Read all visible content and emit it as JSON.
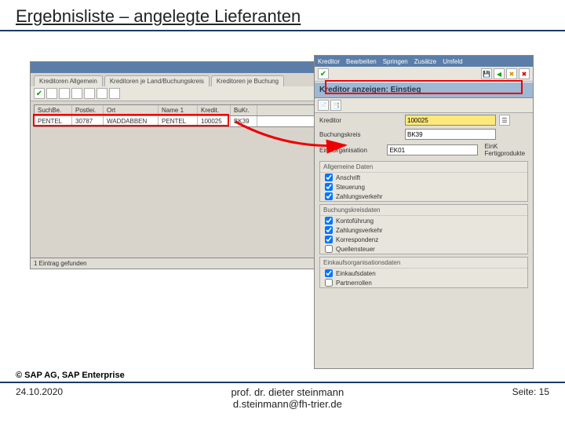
{
  "slide": {
    "title": "Ergebnisliste – angelegte Lieferanten",
    "copyright": "© SAP AG, SAP Enterprise",
    "date": "24.10.2020",
    "author_line1": "prof. dr. dieter steinmann",
    "author_line2": "d.steinmann@fh-trier.de",
    "page": "Seite: 15"
  },
  "win1": {
    "tabs": [
      "Kreditoren Allgemein",
      "Kreditoren je Land/Buchungskreis",
      "Kreditoren je Buchung"
    ],
    "cols": [
      "SuchBe.",
      "Postlei.",
      "Ort",
      "Name 1",
      "Kredit.",
      "BuKr."
    ],
    "row": [
      "PENTEL",
      "30787",
      "WADDABBEN",
      "PENTEL",
      "100025",
      "BK39"
    ],
    "status": "1 Eintrag gefunden"
  },
  "win2": {
    "menu": [
      "Kreditor",
      "Bearbeiten",
      "Springen",
      "Zusätze",
      "Umfeld"
    ],
    "header": "Kreditor anzeigen: Einstieg",
    "fields": {
      "kreditor_label": "Kreditor",
      "kreditor_value": "100025",
      "bukrs_label": "Buchungskreis",
      "bukrs_value": "BK39",
      "ekorg_label": "EinkOrganisation",
      "ekorg_value": "EK01",
      "ekorg_desc": "EinK Fertigprodukte"
    },
    "group1": {
      "title": "Allgemeine Daten",
      "items": [
        "Anschrift",
        "Steuerung",
        "Zahlungsverkehr"
      ]
    },
    "group2": {
      "title": "Buchungskreisdaten",
      "items": [
        "Kontoführung",
        "Zahlungsverkehr",
        "Korrespondenz",
        "Quellensteuer"
      ]
    },
    "group3": {
      "title": "Einkaufsorganisationsdaten",
      "items": [
        "Einkaufsdaten",
        "Partnerrollen"
      ]
    }
  }
}
